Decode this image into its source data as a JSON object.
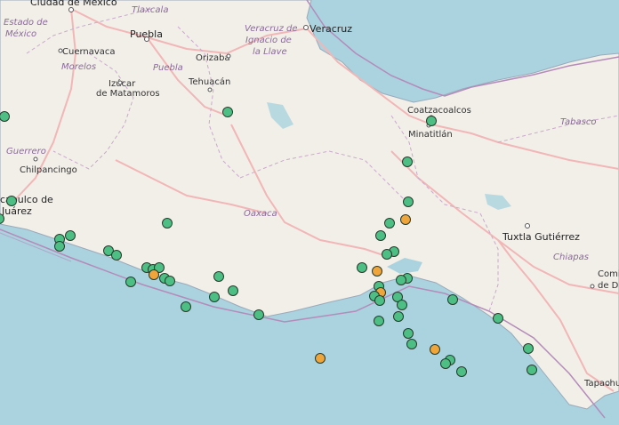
{
  "map": {
    "cities": [
      {
        "id": "ciudad-de-mexico",
        "name": "Ciudad de México"
      },
      {
        "id": "puebla",
        "name": "Puebla"
      },
      {
        "id": "veracruz",
        "name": "Veracruz"
      },
      {
        "id": "cuernavaca",
        "name": "Cuernavaca"
      },
      {
        "id": "orizaba",
        "name": "Orizaba"
      },
      {
        "id": "izucar",
        "name": "Izúcar"
      },
      {
        "id": "de-matamoros",
        "name": "de Matamoros"
      },
      {
        "id": "tehuacan",
        "name": "Tehuacán"
      },
      {
        "id": "coatzacoalcos",
        "name": "Coatzacoalcos"
      },
      {
        "id": "minatitlan",
        "name": "Minatitlán"
      },
      {
        "id": "chilpancingo",
        "name": "Chilpancingo"
      },
      {
        "id": "acapulco-1",
        "name": "capulco de"
      },
      {
        "id": "acapulco-2",
        "name": "Juárez"
      },
      {
        "id": "tuxtla",
        "name": "Tuxtla Gutiérrez"
      },
      {
        "id": "comitan-1",
        "name": "Comi"
      },
      {
        "id": "comitan-2",
        "name": "de Dom"
      },
      {
        "id": "tapachula",
        "name": "Tapachu"
      }
    ],
    "states": [
      {
        "id": "estado-de",
        "name": "Estado de"
      },
      {
        "id": "mexico",
        "name": "México"
      },
      {
        "id": "tlaxcala",
        "name": "Tlaxcala"
      },
      {
        "id": "veracruz-1",
        "name": "Veracruz de"
      },
      {
        "id": "veracruz-2",
        "name": "Ignacio de"
      },
      {
        "id": "veracruz-3",
        "name": "la Llave"
      },
      {
        "id": "morelos",
        "name": "Morelos"
      },
      {
        "id": "puebla-state",
        "name": "Puebla"
      },
      {
        "id": "guerrero",
        "name": "Guerrero"
      },
      {
        "id": "oaxaca",
        "name": "Oaxaca"
      },
      {
        "id": "tabasco",
        "name": "Tabasco"
      },
      {
        "id": "chiapas",
        "name": "Chiapas"
      }
    ],
    "colors": {
      "water": "#aad3df",
      "land": "#f2efe9",
      "road": "#f2b6b6",
      "border": "#b48bb9",
      "quake_green": "#4dbf85",
      "quake_orange": "#f0a53a"
    },
    "earthquake_markers_count": 60
  }
}
